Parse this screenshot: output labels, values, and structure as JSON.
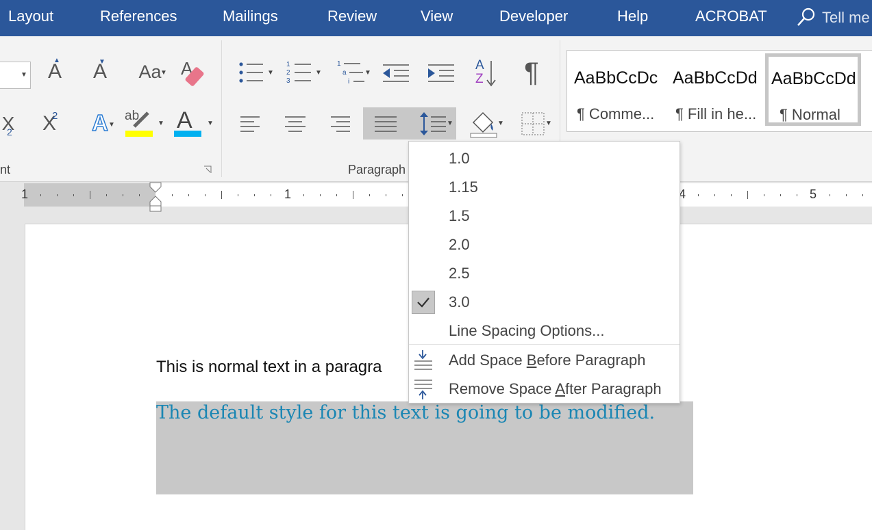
{
  "menubar": {
    "tabs": [
      "Layout",
      "References",
      "Mailings",
      "Review",
      "View",
      "Developer",
      "Help",
      "ACROBAT"
    ],
    "tell_me": "Tell me"
  },
  "ribbon": {
    "font_group_label_fragment": "nt",
    "paragraph_group_label": "Paragraph",
    "grow_font_glyph": "A",
    "shrink_font_glyph": "A",
    "change_case_glyph": "Aa",
    "subscript_glyph": "X",
    "subscript_mark": "2",
    "superscript_glyph": "X",
    "superscript_mark": "2",
    "text_effects_glyph": "A",
    "highlight_glyph": "ab",
    "font_color_glyph": "A",
    "pilcrow_glyph": "¶",
    "sort_glyph_top": "A",
    "sort_glyph_bottom": "Z",
    "colors": {
      "highlight": "#ffff00",
      "font_color": "#00b0f0"
    }
  },
  "styles": [
    {
      "sample": "AaBbCcDc",
      "name": "¶ Comme..."
    },
    {
      "sample": "AaBbCcDd",
      "name": "¶ Fill in he..."
    },
    {
      "sample": "AaBbCcDd",
      "name": "¶ Normal",
      "selected": true
    }
  ],
  "ruler": {
    "numbers": [
      "1",
      "1",
      "4",
      "5"
    ]
  },
  "document": {
    "normal_text": "This is normal text in a paragra",
    "styled_text": "The default style for this text is going to be modified."
  },
  "line_spacing_menu": {
    "items": [
      "1.0",
      "1.15",
      "1.5",
      "2.0",
      "2.5",
      "3.0"
    ],
    "checked_item": "3.0",
    "options": "Line Spacing Options...",
    "add_before": {
      "pre": "Add Space ",
      "key": "B",
      "post": "efore Paragraph"
    },
    "remove_after": {
      "pre": "Remove Space ",
      "key": "A",
      "post": "fter Paragraph"
    }
  }
}
